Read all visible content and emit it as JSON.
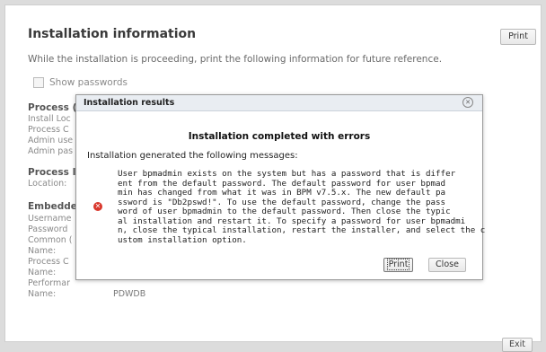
{
  "page": {
    "title": "Installation information",
    "intro": "While the installation is proceeding, print the following information for future reference.",
    "print_label": "Print",
    "show_passwords_label": "Show passwords",
    "exit_label": "Exit"
  },
  "background": {
    "section1_heading": "Process (",
    "section1_lines": [
      "Install Loc",
      "Process C",
      "Admin use",
      "Admin pas"
    ],
    "section2_heading": "Process I",
    "section2_lines": [
      "Location:"
    ],
    "section3_heading": "Embedde",
    "section3_lines": [
      "Username",
      "Password",
      "Common (",
      "Name:",
      "Process C",
      "Name:",
      "Performar",
      "Name:"
    ],
    "last_value": "PDWDB"
  },
  "dialog": {
    "title": "Installation results",
    "close_icon": "close-icon",
    "heading": "Installation completed with errors",
    "subheading": "Installation generated the following messages:",
    "error_icon": "error-icon",
    "message_lines": [
      "User bpmadmin exists on the system but has a password that is differ",
      "ent from the default password. The default password for user bpmad",
      "min has changed from what it was in BPM v7.5.x. The new default pa",
      "ssword is \"Db2pswd!\". To use the default password, change the pass",
      "word of user bpmadmin to the default password. Then close the typic",
      "al installation and restart it. To specify a password for user bpmadmi",
      "n, close the typical installation, restart the installer, and select the c",
      "ustom installation option."
    ],
    "print_label": "Print",
    "close_label": "Close"
  },
  "colors": {
    "error": "#d9362b",
    "dialog_header": "#e9edf2"
  }
}
